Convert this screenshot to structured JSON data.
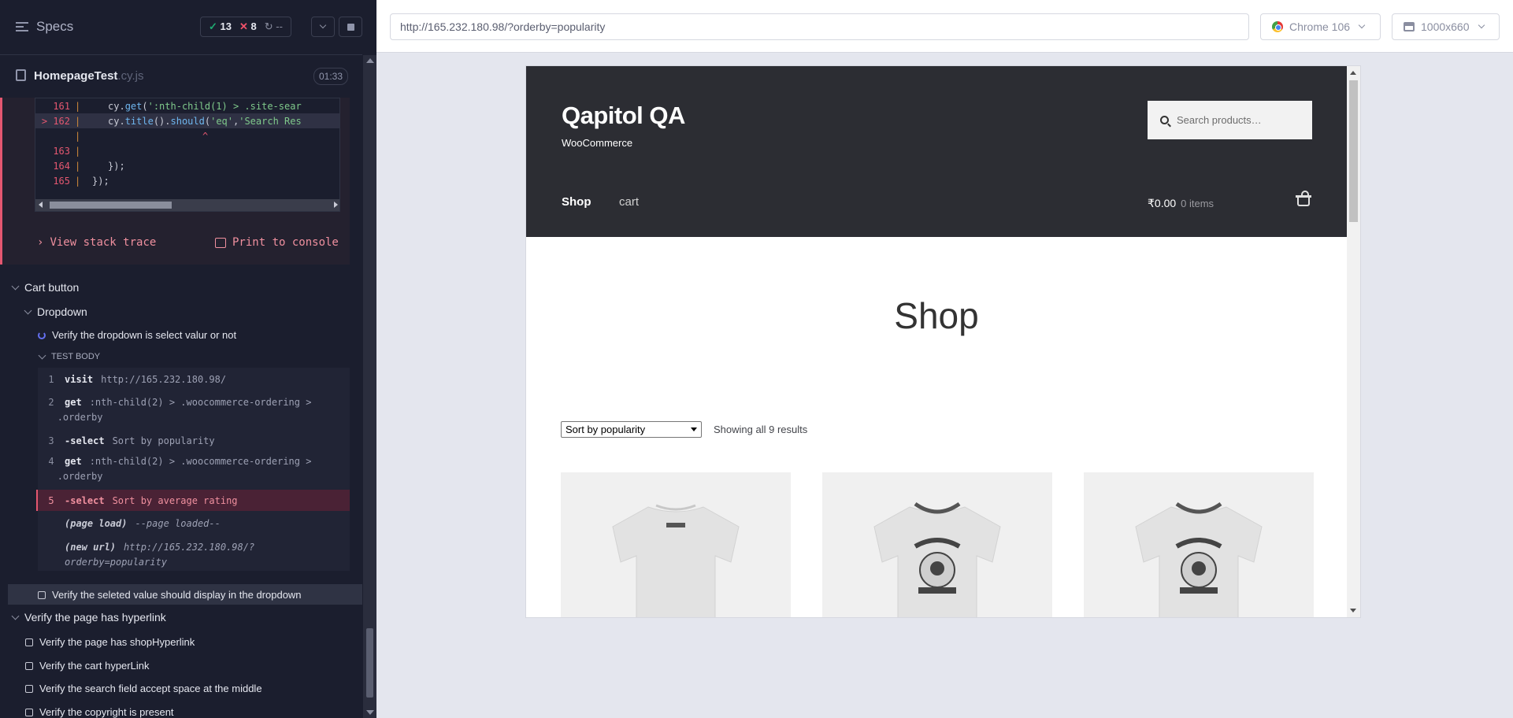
{
  "runner": {
    "specs_label": "Specs",
    "stats": {
      "passed": "13",
      "failed": "8",
      "pending": "--"
    },
    "spec_file": {
      "name": "HomepageTest",
      "ext": ".cy.js",
      "duration": "01:33"
    },
    "code_lines": [
      {
        "num": "161",
        "code": "cy.get(':nth-child(1) > .site-sear"
      },
      {
        "num": "162",
        "code": "cy.title().should('eq','Search Res"
      },
      {
        "num": "",
        "code": "^"
      },
      {
        "num": "163",
        "code": ""
      },
      {
        "num": "164",
        "code": "});"
      },
      {
        "num": "165",
        "code": "});"
      }
    ],
    "view_stack_trace": "View stack trace",
    "print_to_console": "Print to console",
    "suites": {
      "cart_button": "Cart button",
      "dropdown": "Dropdown",
      "test_dropdown": "Verify the dropdown is select valur or not",
      "test_body": "TEST BODY",
      "selected_value_test": "Verify the seleted value should display in the dropdown",
      "hyperlink_suite": "Verify the page has hyperlink",
      "tests": [
        "Verify the page has shopHyperlink",
        "Verify the cart hyperLink",
        "Verify the search field accept space at the middle",
        "Verify the copyright is present"
      ]
    },
    "commands": [
      {
        "idx": "1",
        "name": "visit",
        "msg": "http://165.232.180.98/"
      },
      {
        "idx": "2",
        "name": "get",
        "msg": ":nth-child(2) > .woocommerce-ordering >",
        "msg2": ".orderby"
      },
      {
        "idx": "3",
        "name": "-select",
        "msg": "Sort by popularity"
      },
      {
        "idx": "4",
        "name": "get",
        "msg": ":nth-child(2) > .woocommerce-ordering >",
        "msg2": ".orderby"
      },
      {
        "idx": "5",
        "name": "-select",
        "msg": "Sort by average rating"
      },
      {
        "idx": "",
        "name": "(page load)",
        "msg": "--page loaded--"
      },
      {
        "idx": "",
        "name": "(new url)",
        "msg": "http://165.232.180.98/?",
        "msg2": "orderby=popularity"
      }
    ]
  },
  "aut": {
    "url": "http://165.232.180.98/?orderby=popularity",
    "browser": "Chrome 106",
    "viewport": "1000x660"
  },
  "site": {
    "title": "Qapitol QA",
    "description": "WooCommerce",
    "search_placeholder": "Search products…",
    "nav": {
      "shop": "Shop",
      "cart": "cart"
    },
    "cart_total": "₹0.00",
    "cart_count": "0 items",
    "page_title": "Shop",
    "sort_selected": "Sort by popularity",
    "result_count": "Showing all 9 results"
  },
  "colors": {
    "runner_bg": "#1b1e2e",
    "fail": "#e45770",
    "pass": "#1fa971",
    "site_header": "#2c2d33"
  }
}
